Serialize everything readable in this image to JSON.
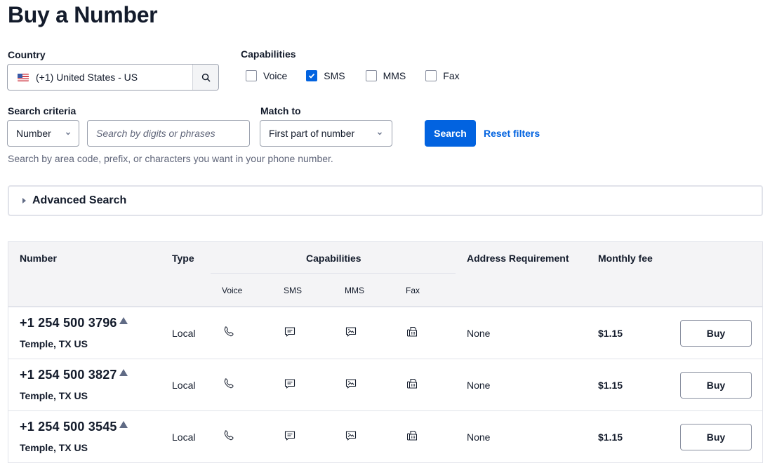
{
  "page": {
    "title": "Buy a Number"
  },
  "country": {
    "label": "Country",
    "value": "(+1) United States - US",
    "flag_icon": "us-flag-icon",
    "search_icon": "search-icon"
  },
  "capabilities": {
    "label": "Capabilities",
    "options": [
      {
        "label": "Voice",
        "checked": false
      },
      {
        "label": "SMS",
        "checked": true
      },
      {
        "label": "MMS",
        "checked": false
      },
      {
        "label": "Fax",
        "checked": false
      }
    ]
  },
  "search": {
    "criteria_label": "Search criteria",
    "criteria_value": "Number",
    "input_placeholder": "Search by digits or phrases",
    "input_value": "",
    "match_label": "Match to",
    "match_value": "First part of number",
    "search_button": "Search",
    "reset_link": "Reset filters",
    "help_text": "Search by area code, prefix, or characters you want in your phone number."
  },
  "advanced": {
    "label": "Advanced Search",
    "expanded": false
  },
  "table": {
    "headers": {
      "number": "Number",
      "type": "Type",
      "capabilities": "Capabilities",
      "address": "Address Requirement",
      "fee": "Monthly fee"
    },
    "sub_headers": [
      "Voice",
      "SMS",
      "MMS",
      "Fax"
    ],
    "rows": [
      {
        "number": "+1 254 500 3796",
        "location": "Temple, TX US",
        "type": "Local",
        "capabilities": [
          "voice",
          "sms",
          "mms",
          "fax"
        ],
        "address": "None",
        "fee": "$1.15",
        "action": "Buy"
      },
      {
        "number": "+1 254 500 3827",
        "location": "Temple, TX US",
        "type": "Local",
        "capabilities": [
          "voice",
          "sms",
          "mms",
          "fax"
        ],
        "address": "None",
        "fee": "$1.15",
        "action": "Buy"
      },
      {
        "number": "+1 254 500 3545",
        "location": "Temple, TX US",
        "type": "Local",
        "capabilities": [
          "voice",
          "sms",
          "mms",
          "fax"
        ],
        "address": "None",
        "fee": "$1.15",
        "action": "Buy"
      }
    ]
  },
  "colors": {
    "primary": "#0263e0",
    "text": "#131b2b",
    "muted": "#60667a",
    "border": "#e1e3ea",
    "header_bg": "#f4f4f6"
  }
}
